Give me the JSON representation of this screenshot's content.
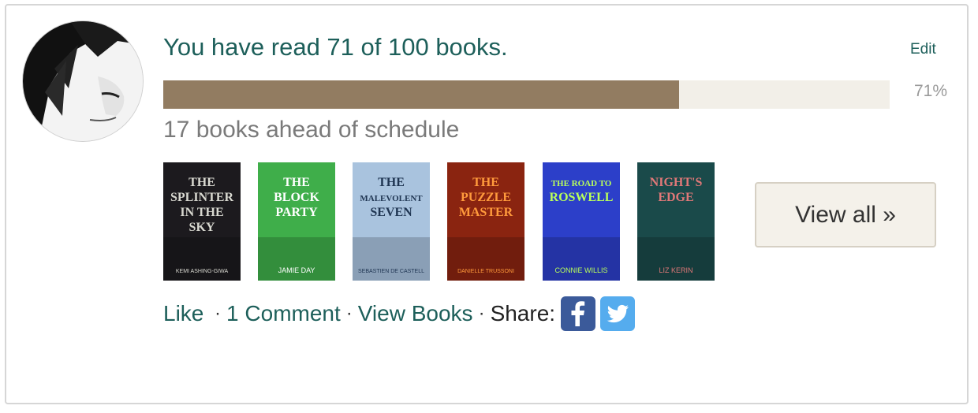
{
  "challenge": {
    "headline": "You have read 71 of 100 books.",
    "read": 71,
    "goal": 100,
    "progress_fraction": 0.71,
    "progress_label": "71%",
    "schedule_text": "17 books ahead of schedule",
    "edit_label": "Edit"
  },
  "books": [
    {
      "title": "The Splinter in the Sky",
      "author": "Kemi Ashing-Giwa",
      "cover_lines": [
        "THE",
        "SPLINTER",
        "IN THE",
        "SKY"
      ],
      "author_line": "KEMI ASHING-GIWA",
      "bg": "#1c1a1e",
      "fg": "#d8d8d0",
      "icon": "book-cover"
    },
    {
      "title": "The Block Party",
      "author": "Jamie Day",
      "cover_lines": [
        "THE",
        "BLOCK",
        "PARTY"
      ],
      "author_line": "JAMIE DAY",
      "bg": "#3fae4a",
      "fg": "#ffffff",
      "icon": "book-cover"
    },
    {
      "title": "The Malevolent Seven",
      "author": "Sebastien de Castell",
      "cover_lines": [
        "THE",
        "MALEVOLENT",
        "SEVEN"
      ],
      "author_line": "SEBASTIEN DE CASTELL",
      "bg": "#a9c3de",
      "fg": "#1f3552",
      "icon": "book-cover"
    },
    {
      "title": "The Puzzle Master",
      "author": "Danielle Trussoni",
      "cover_lines": [
        "THE",
        "PUZZLE",
        "MASTER"
      ],
      "author_line": "DANIELLE TRUSSONI",
      "bg": "#8a2410",
      "fg": "#ff9a3c",
      "icon": "book-cover"
    },
    {
      "title": "The Road to Roswell",
      "author": "Connie Willis",
      "cover_lines": [
        "THE ROAD TO",
        "ROSWELL"
      ],
      "author_line": "CONNIE WILLIS",
      "bg": "#2c3fc9",
      "fg": "#b9ff5a",
      "icon": "book-cover"
    },
    {
      "title": "Night's Edge",
      "author": "Liz Kerin",
      "cover_lines": [
        "NIGHT'S",
        "EDGE"
      ],
      "author_line": "LIZ KERIN",
      "bg": "#1a4a4a",
      "fg": "#e07878",
      "icon": "book-cover"
    }
  ],
  "view_all_label": "View all »",
  "actions": {
    "like": "Like",
    "comment": "1 Comment",
    "view_books": "View Books",
    "share": "Share:"
  },
  "icons": {
    "avatar": "user-avatar",
    "facebook": "facebook-icon",
    "twitter": "twitter-icon"
  },
  "colors": {
    "link": "#1d5f5a",
    "progress_fill": "#927c61",
    "progress_track": "#f2efe8",
    "facebook": "#3b5a9a",
    "twitter": "#55acee"
  }
}
